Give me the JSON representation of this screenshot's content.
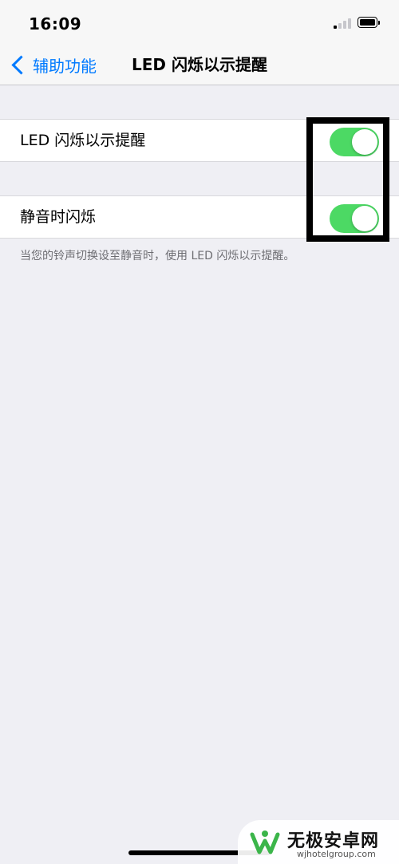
{
  "status_bar": {
    "time": "16:09",
    "signal_icon": "signal-bars-icon",
    "battery_icon": "battery-icon"
  },
  "nav": {
    "back_label": "辅助功能",
    "back_icon": "chevron-left-icon",
    "title": "LED 闪烁以示提醒"
  },
  "settings": [
    {
      "label": "LED 闪烁以示提醒",
      "toggle_on": true
    },
    {
      "label": "静音时闪烁",
      "toggle_on": true
    }
  ],
  "footer_note": "当您的铃声切换设至静音时，使用 LED 闪烁以示提醒。",
  "watermark": {
    "title": "无极安卓网",
    "url": "wjhotelgroup.com"
  },
  "colors": {
    "accent": "#007aff",
    "toggle_on": "#4cd964",
    "background": "#efeff4"
  }
}
